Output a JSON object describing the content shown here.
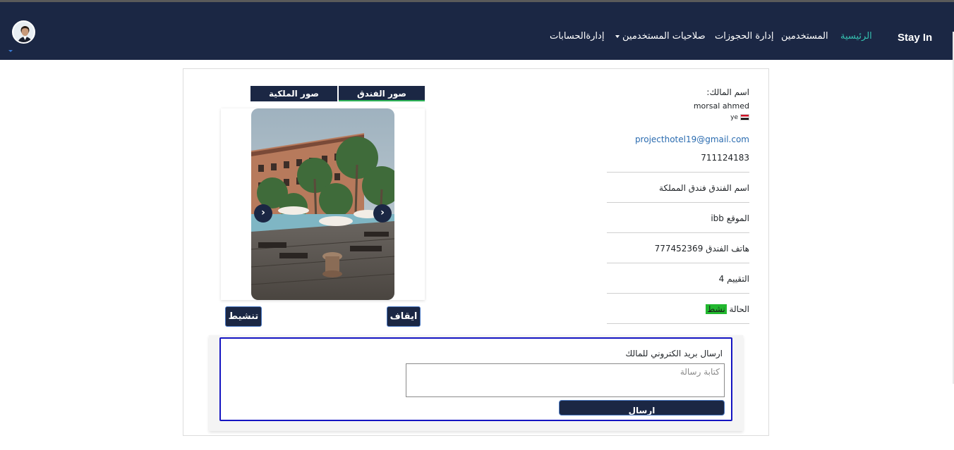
{
  "nav": {
    "brand": "Stay In",
    "items": [
      {
        "label": "الرئيسية",
        "active": true
      },
      {
        "label": "المستخدمين"
      },
      {
        "label": "إدارة الحجوزات"
      },
      {
        "label": "صلاحيات المستخدمين"
      },
      {
        "label": "إدارةالحسابات"
      }
    ]
  },
  "gallery": {
    "tab_hotel": "صور الفندق",
    "tab_royal": "صور الملكية",
    "prev_icon": "‹",
    "next_icon": "›"
  },
  "actions": {
    "stop": "ايقاف",
    "activate": "تنشيط"
  },
  "owner": {
    "label": "اسم المالك:",
    "name": "morsal ahmed",
    "country": "ye",
    "email": "projecthotel19@gmail.com",
    "phone": "711124183"
  },
  "hotel": {
    "name": "اسم الفندق فندق المملكة",
    "location": "الموقع ibb",
    "phone": "هاتف الفندق 777452369",
    "rating": "التقييم 4",
    "status_label": "الحالة",
    "status_value": "نشط"
  },
  "mail": {
    "label": "ارسال بريد الكتروني للمالك",
    "placeholder": "كتابة رسالة",
    "send": "ارسال"
  },
  "colors": {
    "navbar": "#1b2744",
    "active_nav": "#35c0b0",
    "status_active": "#22b82f",
    "mail_border": "#1515c2"
  }
}
